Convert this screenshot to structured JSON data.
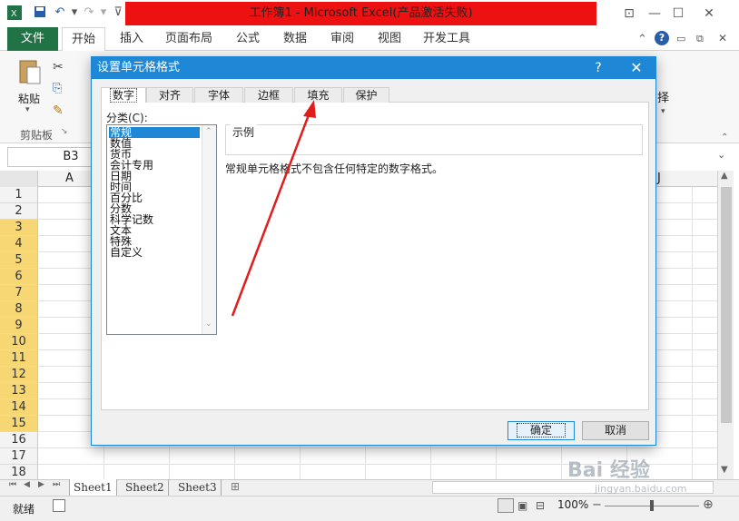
{
  "titlebar": {
    "title": "工作簿1 - Microsoft Excel(产品激活失败)",
    "minimize_icon": "minimize-icon",
    "restore_icon": "restore-icon",
    "close_icon": "close-icon"
  },
  "ribbon": {
    "tabs": [
      "文件",
      "开始",
      "插入",
      "页面布局",
      "公式",
      "数据",
      "审阅",
      "视图",
      "开发工具"
    ],
    "paste_label": "粘贴",
    "clipboard_label": "剪贴板",
    "right_label": "择"
  },
  "formula_bar": {
    "name_box": "B3"
  },
  "grid": {
    "columns": [
      "A",
      "J"
    ],
    "rows": [
      "1",
      "2",
      "3",
      "4",
      "5",
      "6",
      "7",
      "8",
      "9",
      "10",
      "11",
      "12",
      "13",
      "14",
      "15",
      "16",
      "17",
      "18"
    ],
    "selected_rows": [
      "3",
      "4",
      "5",
      "6",
      "7",
      "8",
      "9",
      "10",
      "11",
      "12",
      "13",
      "14",
      "15"
    ]
  },
  "sheet_tabs": [
    "Sheet1",
    "Sheet2",
    "Sheet3"
  ],
  "status_bar": {
    "mode": "就绪",
    "zoom": "100%"
  },
  "dialog": {
    "title": "设置单元格格式",
    "help": "?",
    "tabs": [
      "数字",
      "对齐",
      "字体",
      "边框",
      "填充",
      "保护"
    ],
    "active_tab": "数字",
    "category_label": "分类(C):",
    "categories": [
      "常规",
      "数值",
      "货币",
      "会计专用",
      "日期",
      "时间",
      "百分比",
      "分数",
      "科学记数",
      "文本",
      "特殊",
      "自定义"
    ],
    "selected_category": "常规",
    "sample_label": "示例",
    "description": "常规单元格格式不包含任何特定的数字格式。",
    "ok_label": "确定",
    "cancel_label": "取消"
  },
  "annotation": {
    "arrow_color": "#e21b1b"
  },
  "watermark": {
    "text": "Bai 经验",
    "sub": "jingyan.baidu.com"
  },
  "colors": {
    "excel_green": "#217346",
    "dialog_blue": "#1e88d6",
    "title_red": "#ee1111",
    "selected_row": "#f7d774"
  }
}
